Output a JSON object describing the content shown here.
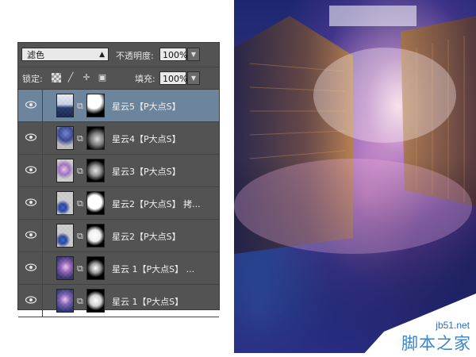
{
  "layers_panel": {
    "blend_mode": "滤色",
    "opacity_label": "不透明度:",
    "opacity_value": "100%",
    "lock_label": "锁定:",
    "fill_label": "填充:",
    "fill_value": "100%",
    "layers": [
      {
        "name": "星云5【P大点S】",
        "selected": true,
        "visible": true
      },
      {
        "name": "星云4【P大点S】",
        "selected": false,
        "visible": true
      },
      {
        "name": "星云3【P大点S】",
        "selected": false,
        "visible": true
      },
      {
        "name": "星云2【P大点S】 拷...",
        "selected": false,
        "visible": true
      },
      {
        "name": "星云2【P大点S】",
        "selected": false,
        "visible": true
      },
      {
        "name": "星云 1【P大点S】 ...",
        "selected": false,
        "visible": true
      },
      {
        "name": "星云 1【P大点S】",
        "selected": false,
        "visible": true
      }
    ],
    "icons": [
      "eye-icon",
      "chain-link-icon",
      "lock-transparent-icon",
      "lock-brush-icon",
      "lock-move-icon",
      "lock-all-icon",
      "dropdown-arrow-icon"
    ]
  },
  "watermark": {
    "url": "jb51.net",
    "site_name": "脚本之家"
  },
  "colors": {
    "panel_bg": "#535353",
    "selected_row": "#6d849d",
    "watermark_blue": "#3b85c7"
  }
}
